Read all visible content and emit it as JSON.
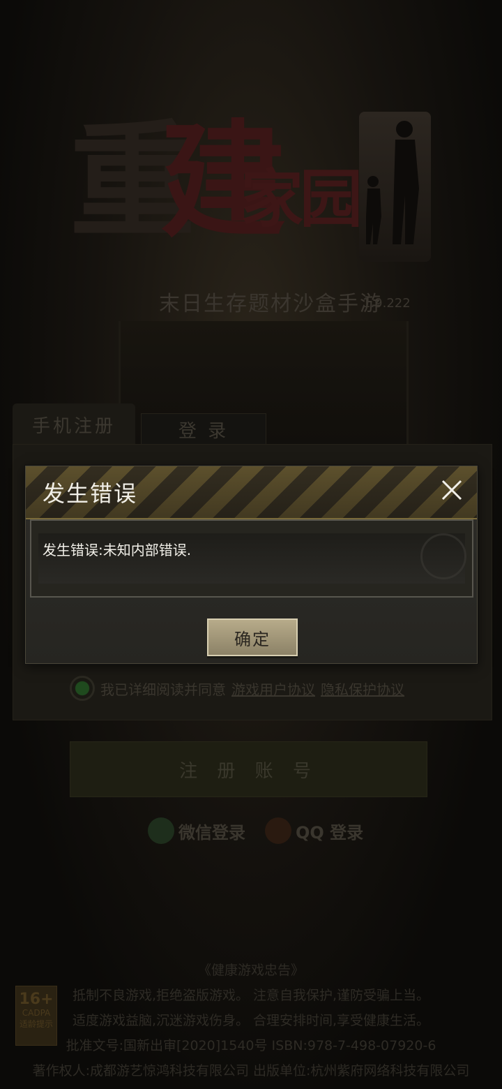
{
  "logo": {
    "chars": [
      "重",
      "建",
      "家",
      "园"
    ]
  },
  "subtitle": "末日生存题材沙盒手游",
  "version": "1.9.222",
  "tabs": {
    "register": "手机注册",
    "login": "登 录"
  },
  "agreement": {
    "text": "我已详细阅读并同意",
    "link1": "游戏用户协议",
    "link2": "隐私保护协议"
  },
  "register_button": "注 册 账 号",
  "social": {
    "wechat": "微信登录",
    "qq": "QQ 登录"
  },
  "footer": {
    "title": "《健康游戏忠告》",
    "line1": "抵制不良游戏,拒绝盗版游戏。 注意自我保护,谨防受骗上当。",
    "line2": "适度游戏益脑,沉迷游戏伤身。 合理安排时间,享受健康生活。",
    "line3": "批准文号:国新出审[2020]1540号 ISBN:978-7-498-07920-6",
    "line4": "著作权人:成都游艺惊鸿科技有限公司 出版单位:杭州紫府网络科技有限公司"
  },
  "age_badge": {
    "age": "16+",
    "org": "CADPA",
    "label": "适龄提示"
  },
  "dialog": {
    "title": "发生错误",
    "message": "发生错误:未知内部错误.",
    "confirm": "确定"
  },
  "colors": {
    "header_stripe": "#6e5f33",
    "accent_green": "#1f4a1e"
  }
}
